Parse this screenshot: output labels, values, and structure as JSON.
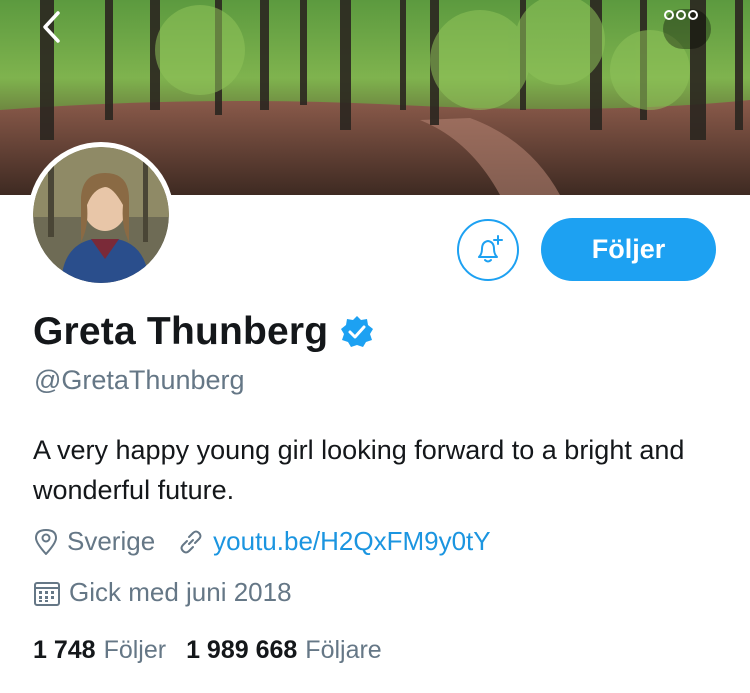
{
  "header": {
    "back_icon": "chevron-left-icon",
    "more_icon": "more-dots-icon"
  },
  "profile": {
    "name": "Greta Thunberg",
    "verified_icon": "verified-badge-icon",
    "handle": "@GretaThunberg",
    "bio": "A very happy young girl looking forward to a bright and wonderful future.",
    "location": "Sverige",
    "link": "youtu.be/H2QxFM9y0tY",
    "joined": "Gick med juni 2018"
  },
  "actions": {
    "notify_icon": "bell-plus-icon",
    "follow_label": "Följer"
  },
  "stats": {
    "following_count": "1 748",
    "following_label": "Följer",
    "followers_count": "1 989 668",
    "followers_label": "Följare"
  },
  "colors": {
    "accent": "#1da1f2",
    "link": "#1b95e0",
    "text": "#14171a",
    "muted": "#657786"
  }
}
